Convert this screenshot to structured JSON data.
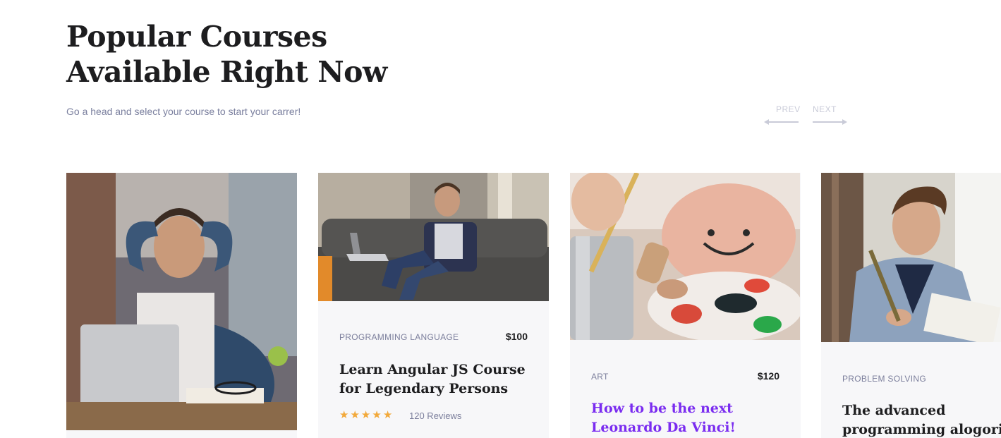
{
  "section": {
    "title_line1": "Popular Courses",
    "title_line2": "Available Right Now",
    "subtitle": "Go a head and select your course to start your carrer!"
  },
  "nav": {
    "prev_label": "PREV",
    "next_label": "NEXT"
  },
  "colors": {
    "accent": "#7a2cf0",
    "star": "#f2a93b",
    "muted_text": "#7c7f9c",
    "card_bg": "#f7f7f9"
  },
  "courses": [
    {
      "image": "man-relaxing-at-laptop",
      "category": "",
      "price": "",
      "title_line1": "",
      "title_line2": ""
    },
    {
      "image": "man-on-sofa-with-laptop",
      "category": "PROGRAMMING LANGUAGE",
      "price": "$100",
      "title_line1": "Learn Angular JS Course",
      "title_line2": "for Legendary Persons",
      "rating": 5,
      "reviews": "120 Reviews"
    },
    {
      "image": "painting-palette",
      "category": "ART",
      "price": "$120",
      "title_line1": "How to be the next",
      "title_line2": "Leonardo Da Vinci!"
    },
    {
      "image": "student-reading-book",
      "category": "PROBLEM SOLVING",
      "price": "",
      "title_line1": "The advanced",
      "title_line2": "programming alogorith"
    }
  ]
}
